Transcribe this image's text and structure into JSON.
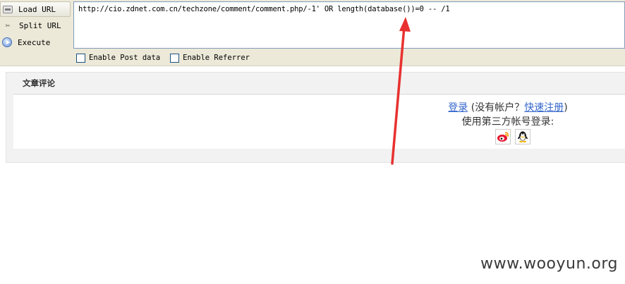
{
  "toolbar": {
    "load_url_label": "Load URL",
    "split_url_label": "Split URL",
    "execute_label": "Execute",
    "url_value": "http://cio.zdnet.com.cn/techzone/comment/comment.php/-1' OR length(database())=0 -- /1",
    "enable_post_label": "Enable Post data",
    "enable_referrer_label": "Enable Referrer"
  },
  "page": {
    "section_title": "文章评论",
    "login_link": "登录",
    "no_account_text": "(没有帐户？",
    "register_link": "快速注册",
    "close_paren": ")",
    "third_party_text": "使用第三方帐号登录:"
  },
  "colors": {
    "arrow": "#e8312f",
    "link": "#3366cc"
  },
  "icons": [
    "load-url-icon",
    "split-url-icon",
    "execute-icon",
    "weibo-icon",
    "qq-icon"
  ],
  "watermark": "www.wooyun.org"
}
